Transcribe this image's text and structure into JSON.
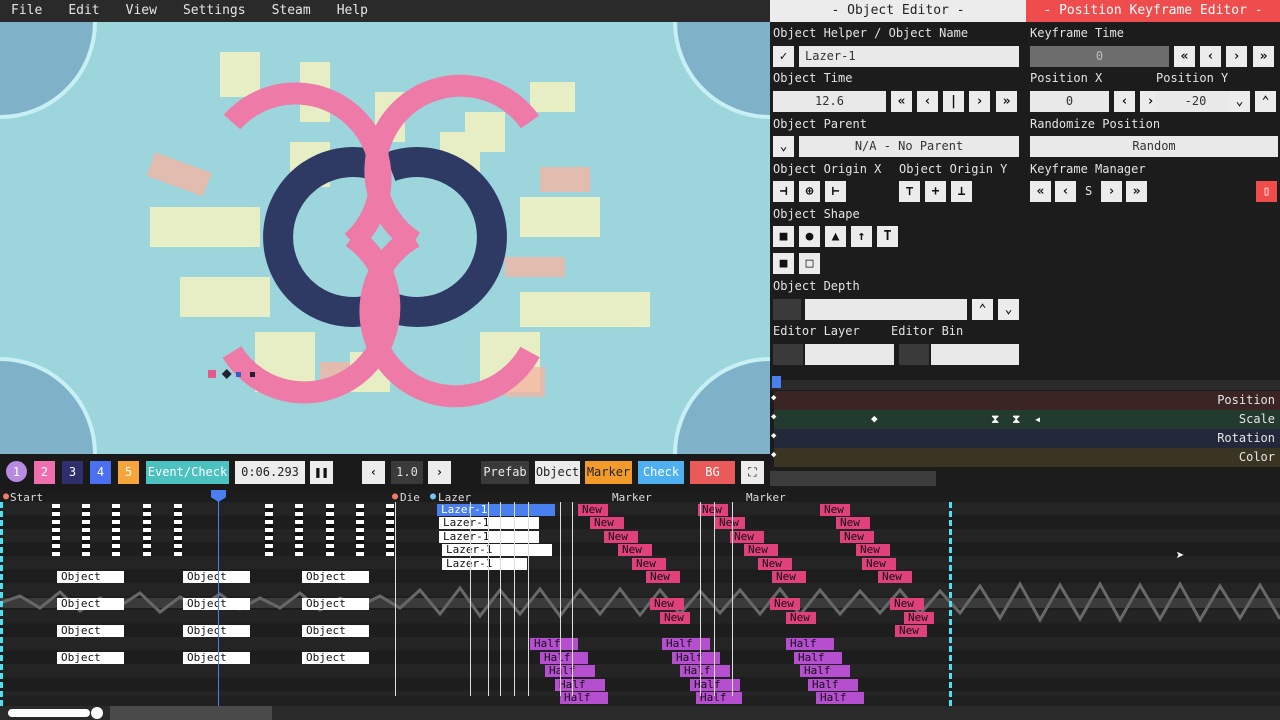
{
  "menu": [
    "File",
    "Edit",
    "View",
    "Settings",
    "Steam",
    "Help"
  ],
  "object_editor": {
    "title": "- Object Editor -",
    "helper_label": "Object Helper / Object Name",
    "object_name": "Lazer-1",
    "time_label": "Object Time",
    "time_value": "12.6",
    "parent_label": "Object Parent",
    "parent_value": "N/A - No Parent",
    "origin_x_label": "Object Origin X",
    "origin_y_label": "Object Origin Y",
    "shape_label": "Object Shape",
    "depth_label": "Object Depth",
    "layer_label": "Editor Layer",
    "bin_label": "Editor Bin"
  },
  "keyframe_editor": {
    "title": "- Position Keyframe Editor -",
    "time_label": "Keyframe Time",
    "time_value": "0",
    "pos_x_label": "Position X",
    "pos_x_value": "0",
    "pos_y_label": "Position Y",
    "pos_y_value": "-20",
    "randomize_label": "Randomize Position",
    "randomize_button": "Random",
    "manager_label": "Keyframe Manager",
    "manager_mid": "S"
  },
  "kf_rows": [
    "Position",
    "Scale",
    "Rotation",
    "Color"
  ],
  "kf_row_colors": [
    "#3a2626",
    "#263a30",
    "#262a3a",
    "#3a3626"
  ],
  "toolbar": {
    "layers": [
      "1",
      "2",
      "3",
      "4",
      "5"
    ],
    "layer_colors": [
      "#b98be0",
      "#ef6fae",
      "#3a3a8a",
      "#4a6ff0",
      "#f5a53a"
    ],
    "event_check": "Event/Check",
    "time": "0:06.293",
    "speed": "1.0",
    "prefab": "Prefab",
    "object": "Object",
    "marker": "Marker",
    "check": "Check",
    "bg": "BG"
  },
  "timeline": {
    "start_marker": "Start",
    "markers": [
      "Die",
      "Lazer",
      "Marker",
      "Marker"
    ],
    "lazer_items": [
      "Lazer-1",
      "Lazer-1",
      "Lazer-1",
      "Lazer-1",
      "Lazer-1"
    ],
    "object_label": "Object",
    "new_label": "New",
    "half_label": "Half"
  }
}
